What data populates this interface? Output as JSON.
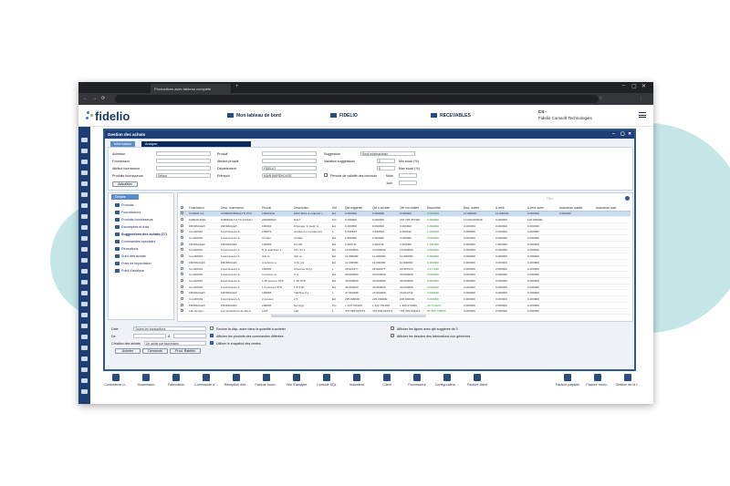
{
  "browser": {
    "tab_title": "Productions avec tableau complete",
    "url": "",
    "new_tab": "+",
    "back": "←",
    "forward": "→",
    "reload": "⟳"
  },
  "app": {
    "logo": "fidelio"
  },
  "header": {
    "nav1": "Mon tableau de bord",
    "nav2": "FIDELIO",
    "nav3": "RECEVABLES",
    "user_code": "CS -",
    "company": "Fidelio Comsoft Technologies"
  },
  "dialog": {
    "title": "Gestion des achats",
    "tabs": [
      "Information",
      "Analyse"
    ],
    "filters": {
      "acheteur": "Acheteur",
      "fournisseur": "Fournisseur",
      "attr_fournisseur": "Attribut fournisseur",
      "produits_fournisseurs": "Produits fournisseurs",
      "produits_fournisseurs_value": "Défaut",
      "produit": "Produit",
      "attr_produit": "Attribut produit",
      "departement": "Département",
      "departement_value": "FIDELIO",
      "entrepot": "Entrepôt",
      "entrepot_value": "MAIN WAREHOUSE",
      "suggestion": "Suggestion",
      "suggestion_value": "Seuil min/max/max",
      "variation": "Variation suggestions",
      "variation_value": "0",
      "min_stock": "Min stock (%)",
      "max_stock": "Max stock (%)",
      "max_value": "0",
      "periode": "Période de validité des min/max",
      "mois": "Mois",
      "jour": "Jour",
      "actualiser": "Actualiser"
    },
    "tree": {
      "header": "Détails",
      "items": [
        "Produits",
        "Fournisseurs",
        "Produits fournisseurs",
        "Escomptes et frais",
        "Suggestions des achats (17)",
        "Commandes spéciales",
        "Réceptions",
        "Suivi des achats",
        "Frais de importation",
        "Point d'analyse"
      ]
    },
    "grid": {
      "search_placeholder": "Filtre",
      "columns": [
        "",
        "Fournisseur",
        "Desc. fournisseur",
        "Produit",
        "Description",
        "UM",
        "Qté suggérée",
        "Qté à acheter",
        "Qté non traitée",
        "Disponible",
        "Disp. autres",
        "A venir",
        "A venir autre",
        "Assurance qualité",
        "Assurance qual"
      ],
      "rows": [
        [
          "COMM1-G1",
          "COMMONWEALTH PO1",
          "100001S0",
          "MAX Boîte à empoter (...",
          "EA",
          "0.000000",
          "0.000000",
          "0.000000",
          "0.000000",
          "11.000000",
          "11.000000",
          "0.000000",
          "0.000000"
        ],
        [
          "FAB100-DSE",
          "FABRICE T.0.T.F.CASAU",
          "240000003",
          "DALT",
          "KG",
          "0.000000",
          "0.000000",
          "333 725.367397",
          "0.000000",
          "13 000.000048",
          "0.000000",
          "100.000000"
        ],
        [
          "FROMAGEX",
          "FROMAGEX",
          "100004",
          "Fromage 'À Gelé' to",
          "EA",
          "0.000000",
          "0.000000",
          "0.000000",
          "0.000000",
          "0.000000",
          "0.000000",
          "0.000000"
        ],
        [
          "Com00001",
          "Fournisseurs A",
          "100076",
          "Amidon Le Lemais (kl)",
          "L",
          "5.646524",
          "3.646524",
          "3.390332",
          "1.000048",
          "0.000000",
          "0.000000",
          "0.000000"
        ],
        [
          "Com00001",
          "Fournisseurs A",
          "Vin Épi",
          "Vin Épi",
          "EA",
          "2.500000",
          "2.500000",
          "0.000000",
          "0.000000",
          "0.000000",
          "0.000000",
          "0.000000"
        ],
        [
          "FROMAGEX",
          "FROMAGEX",
          "100069",
          "CC-06",
          "EA",
          "2.200711",
          "2.200711",
          "3.163000",
          "1.041200",
          "0.000000",
          "1.800000",
          "0.000000"
        ],
        [
          "Com00001",
          "Fournisseurs A",
          "5_9-quatTo1x 1",
          "1% c1x 1",
          "EA",
          "10.000000",
          "10.000000",
          "10.000000",
          "0.000000",
          "0.000000",
          "0.000000",
          "0.000000"
        ],
        [
          "Com00001",
          "Fournisseurs A",
          "4pn re",
          "4pn re",
          "EA",
          "11.000000",
          "11.000000",
          "11.000000",
          "0.000000",
          "0.000000",
          "0.000000",
          "0.000000"
        ],
        [
          "FROMAGEX",
          "FROMAGEX",
          "4 poivres re",
          "4 Xx pnr",
          "EA",
          "11.000000",
          "11.000000",
          "11.000000",
          "0.000000",
          "0.000000",
          "0.000000",
          "0.000000"
        ],
        [
          "Com00001",
          "Fournisseurs A",
          "100006",
          "Chemise M (L)",
          "L",
          "28.924477",
          "28.924477",
          "20.397013",
          "4.177240",
          "0.000000",
          "0.000000",
          "0.000000"
        ],
        [
          "Com00001",
          "Fournisseurs A",
          "3 poivres re",
          "3 re",
          "EA",
          "30.000000",
          "30.000000",
          "30.000000",
          "0.000000",
          "0.000000",
          "0.000000",
          "0.000000"
        ],
        [
          "Com00001",
          "Fournisseurs A",
          "1.25 pouces STD",
          "1.25 STD",
          "EA",
          "40.000000",
          "40.000000",
          "40.000000",
          "0.000000",
          "0.000000",
          "0.000000",
          "0.000000"
        ],
        [
          "Com00001",
          "Fournisseurs A",
          "1.5 pouces STD",
          "1.5 STD",
          "EA",
          "40.000000",
          "40.000000",
          "40.000000",
          "0.000000",
          "0.000000",
          "0.000000",
          "0.000000"
        ],
        [
          "FROMAGEX",
          "FROMAGEX",
          "100068",
          "Yakibise (L)",
          "L",
          "47.962298",
          "47.962298",
          "22.613742",
          "4.040440",
          "0.000000",
          "0.000000",
          "0.000000"
        ],
        [
          "Com00001",
          "Fournisseurs A",
          "2 pouces",
          "2.5",
          "EA",
          "225.000000",
          "225.000000",
          "225.000000",
          "0.000000",
          "0.000000",
          "0.000000",
          "0.000000"
        ],
        [
          "FROMAGEX",
          "FROMAGEX",
          "100045",
          "Sel (kg)",
          "KG",
          "1 433.701209",
          "1 433.701209",
          "1 460.474000",
          "46.773420",
          "0.000000",
          "0.000000",
          "0.000000"
        ],
        [
          "Lait du Qué...",
          "Les producteur de lait d...",
          "LAIT",
          "Lait",
          "L",
          "470 999.016472",
          "470 999.016472",
          "754 449.636419",
          "85 450.730000",
          "0.000000",
          "0.000000",
          "0.000000"
        ]
      ]
    },
    "footer": {
      "date_label": "Date",
      "date_value": "Toutes les transactions",
      "de_label": "De",
      "a_label": "À",
      "creation_label": "Création des achats",
      "creation_value": "Un achat par fournisseur",
      "btn_acheter": "Acheter",
      "btn_demande": "Demande",
      "btn_prod": "Prod. Rabbits",
      "chk1": "Exclure la disp. autre dans la quantité à acheter",
      "chk2": "Afficher les produits des commandes différées",
      "chk3": "Utiliser le snapshot des ventes",
      "chk4": "Afficher les lignes avec qté suggérée de 0",
      "chk5": "Afficher les besoins des fabrications non générées"
    }
  },
  "toolbar": [
    "Commande d...",
    "Soumission",
    "Fabrication",
    "Commande d'...",
    "Réception des...",
    "Facture fourn...",
    "Vue d'analyse",
    "Console SQL",
    "Indicateur",
    "Client",
    "Fournisseur",
    "Configurateur ...",
    "Facture client",
    "Facture payable",
    "Facture recev...",
    "Gestion de la f..."
  ],
  "colors": {
    "brand": "#1e3f76",
    "accent": "#5b8dc9",
    "green": "#2e8b2e",
    "bg_shape": "#c5e6e7"
  }
}
